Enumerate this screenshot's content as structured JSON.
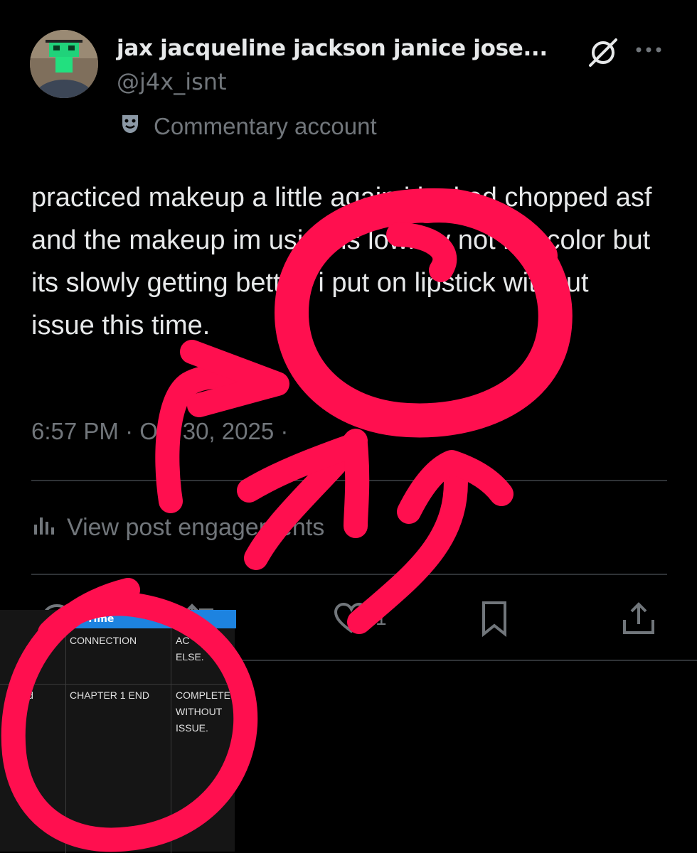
{
  "author": {
    "display_name": "jax jacqueline jackson janice jose...",
    "handle": "@j4x_isnt",
    "badge_label": "Commentary account",
    "badge_icon": "theater-masks-icon"
  },
  "post": {
    "text": "practiced makeup a little again i looked chopped asf and the makeup im using is lowkey not my color but its slowly getting better. i put on lipstick without issue this time.",
    "timestamp": "6:57 PM · Oct 30, 2025 ·"
  },
  "engagements": {
    "label": "View post engagements"
  },
  "actions": {
    "like_count": "1"
  },
  "table_overlay": {
    "header": "Time",
    "rows": [
      [
        "",
        "CONNECTION",
        "AC... ELSE."
      ],
      [
        "ld",
        "CHAPTER 1 END",
        "COMPLETE WITHOUT ISSUE."
      ]
    ],
    "row1_col3_line1": "AC",
    "row1_col3_line2": "ELSE.",
    "row2_col1": "ld",
    "row2_col2": "CHAPTER 1 END",
    "row2_col3_line1": "COMPLETE",
    "row2_col3_line2": "WITHOUT",
    "row2_col3_line3": "ISSUE.",
    "row1_col2": "CONNECTION",
    "header_color": "#1d83e0"
  },
  "colors": {
    "background": "#000000",
    "text_primary": "#e7e9ea",
    "text_secondary": "#71767b",
    "divider": "#2f3336",
    "annotation": "#ff0f4f"
  }
}
